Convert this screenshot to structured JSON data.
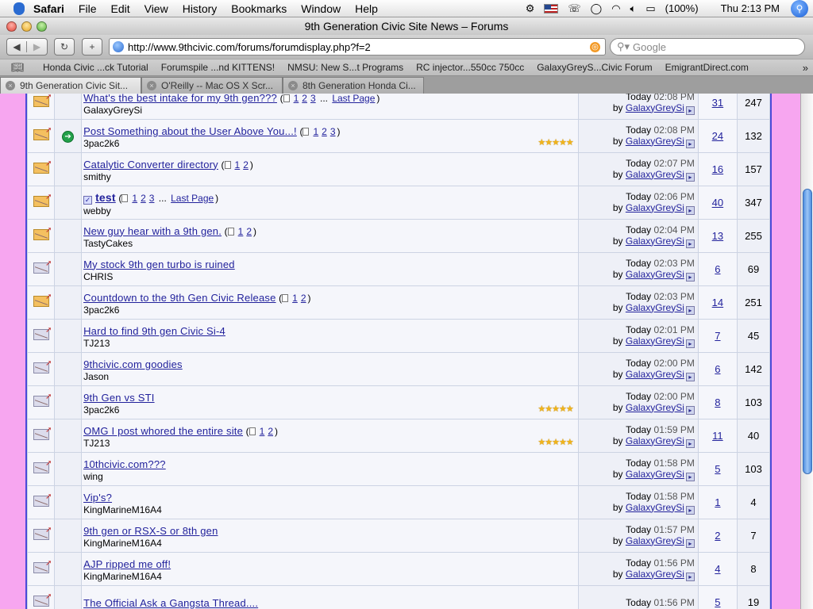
{
  "menubar": {
    "app": "Safari",
    "items": [
      "File",
      "Edit",
      "View",
      "History",
      "Bookmarks",
      "Window",
      "Help"
    ],
    "battery": "(100%)",
    "clock": "Thu 2:13 PM"
  },
  "window": {
    "title": "9th Generation Civic Site News – Forums"
  },
  "toolbar": {
    "url": "http://www.9thcivic.com/forums/forumdisplay.php?f=2",
    "search_placeholder": "Google"
  },
  "bookmarks": [
    "Honda Civic ...ck Tutorial",
    "Forumspile ...nd KITTENS!",
    "NMSU: New S...t Programs",
    "RC injector...550cc 750cc",
    "GalaxyGreyS...Civic Forum",
    "EmigrantDirect.com"
  ],
  "tabs": [
    "9th Generation Civic Sit...",
    "O'Reilly -- Mac OS X Scr...",
    "8th Generation Honda Ci..."
  ],
  "threads": [
    {
      "title": "What's the best intake for my 9th gen???",
      "pages": [
        "1",
        "2",
        "3"
      ],
      "lastpage": "Last Page",
      "author": "GalaxyGreySi",
      "date": "Today",
      "time": "02:08 PM",
      "by": "by",
      "lastposter": "GalaxyGreySi",
      "replies": "31",
      "views": "247",
      "icon": "hot",
      "stars": false,
      "newarrow": false,
      "bold": false
    },
    {
      "title": "Post Something about the User Above You...!",
      "pages": [
        "1",
        "2",
        "3"
      ],
      "lastpage": "",
      "author": "3pac2k6",
      "date": "Today",
      "time": "02:08 PM",
      "by": "by",
      "lastposter": "GalaxyGreySi",
      "replies": "24",
      "views": "132",
      "icon": "hot",
      "stars": true,
      "newarrow": true,
      "bold": false
    },
    {
      "title": "Catalytic Converter directory",
      "pages": [
        "1",
        "2"
      ],
      "lastpage": "",
      "author": "smithy",
      "date": "Today",
      "time": "02:07 PM",
      "by": "by",
      "lastposter": "GalaxyGreySi",
      "replies": "16",
      "views": "157",
      "icon": "hot",
      "stars": false,
      "newarrow": false,
      "bold": false
    },
    {
      "title": "test",
      "pages": [
        "1",
        "2",
        "3"
      ],
      "lastpage": "Last Page",
      "author": "webby",
      "date": "Today",
      "time": "02:06 PM",
      "by": "by",
      "lastposter": "GalaxyGreySi",
      "replies": "40",
      "views": "347",
      "icon": "hot",
      "stars": false,
      "newarrow": false,
      "bold": true
    },
    {
      "title": "New guy hear with a 9th gen.",
      "pages": [
        "1",
        "2"
      ],
      "lastpage": "",
      "author": "TastyCakes",
      "date": "Today",
      "time": "02:04 PM",
      "by": "by",
      "lastposter": "GalaxyGreySi",
      "replies": "13",
      "views": "255",
      "icon": "hot",
      "stars": false,
      "newarrow": false,
      "bold": false
    },
    {
      "title": "My stock 9th gen turbo is ruined",
      "pages": [],
      "lastpage": "",
      "author": "CHRIS",
      "date": "Today",
      "time": "02:03 PM",
      "by": "by",
      "lastposter": "GalaxyGreySi",
      "replies": "6",
      "views": "69",
      "icon": "read",
      "stars": false,
      "newarrow": false,
      "bold": false
    },
    {
      "title": "Countdown to the 9th Gen Civic Release",
      "pages": [
        "1",
        "2"
      ],
      "lastpage": "",
      "author": "3pac2k6",
      "date": "Today",
      "time": "02:03 PM",
      "by": "by",
      "lastposter": "GalaxyGreySi",
      "replies": "14",
      "views": "251",
      "icon": "hot",
      "stars": false,
      "newarrow": false,
      "bold": false
    },
    {
      "title": "Hard to find 9th gen Civic Si-4",
      "pages": [],
      "lastpage": "",
      "author": "TJ213",
      "date": "Today",
      "time": "02:01 PM",
      "by": "by",
      "lastposter": "GalaxyGreySi",
      "replies": "7",
      "views": "45",
      "icon": "read",
      "stars": false,
      "newarrow": false,
      "bold": false
    },
    {
      "title": "9thcivic.com goodies",
      "pages": [],
      "lastpage": "",
      "author": "Jason",
      "date": "Today",
      "time": "02:00 PM",
      "by": "by",
      "lastposter": "GalaxyGreySi",
      "replies": "6",
      "views": "142",
      "icon": "read",
      "stars": false,
      "newarrow": false,
      "bold": false
    },
    {
      "title": "9th Gen vs STI",
      "pages": [],
      "lastpage": "",
      "author": "3pac2k6",
      "date": "Today",
      "time": "02:00 PM",
      "by": "by",
      "lastposter": "GalaxyGreySi",
      "replies": "8",
      "views": "103",
      "icon": "read",
      "stars": true,
      "newarrow": false,
      "bold": false
    },
    {
      "title": "OMG I post whored the entire site",
      "pages": [
        "1",
        "2"
      ],
      "lastpage": "",
      "author": "TJ213",
      "date": "Today",
      "time": "01:59 PM",
      "by": "by",
      "lastposter": "GalaxyGreySi",
      "replies": "11",
      "views": "40",
      "icon": "read",
      "stars": true,
      "newarrow": false,
      "bold": false
    },
    {
      "title": "10thcivic.com???",
      "pages": [],
      "lastpage": "",
      "author": "wing",
      "date": "Today",
      "time": "01:58 PM",
      "by": "by",
      "lastposter": "GalaxyGreySi",
      "replies": "5",
      "views": "103",
      "icon": "read",
      "stars": false,
      "newarrow": false,
      "bold": false
    },
    {
      "title": "Vip's?",
      "pages": [],
      "lastpage": "",
      "author": "KingMarineM16A4",
      "date": "Today",
      "time": "01:58 PM",
      "by": "by",
      "lastposter": "GalaxyGreySi",
      "replies": "1",
      "views": "4",
      "icon": "read",
      "stars": false,
      "newarrow": false,
      "bold": false
    },
    {
      "title": "9th gen or RSX-S or 8th gen",
      "pages": [],
      "lastpage": "",
      "author": "KingMarineM16A4",
      "date": "Today",
      "time": "01:57 PM",
      "by": "by",
      "lastposter": "GalaxyGreySi",
      "replies": "2",
      "views": "7",
      "icon": "read",
      "stars": false,
      "newarrow": false,
      "bold": false
    },
    {
      "title": "AJP ripped me off!",
      "pages": [],
      "lastpage": "",
      "author": "KingMarineM16A4",
      "date": "Today",
      "time": "01:56 PM",
      "by": "by",
      "lastposter": "GalaxyGreySi",
      "replies": "4",
      "views": "8",
      "icon": "read",
      "stars": false,
      "newarrow": false,
      "bold": false
    },
    {
      "title": "The Official Ask a Gangsta Thread....",
      "pages": [],
      "lastpage": "",
      "author": "",
      "date": "Today",
      "time": "01:56 PM",
      "by": "",
      "lastposter": "",
      "replies": "5",
      "views": "19",
      "icon": "read",
      "stars": false,
      "newarrow": false,
      "bold": false
    }
  ],
  "colors": {
    "page_bg": "#f7a6f0",
    "border": "#4a4ad8",
    "link": "#22229c"
  }
}
